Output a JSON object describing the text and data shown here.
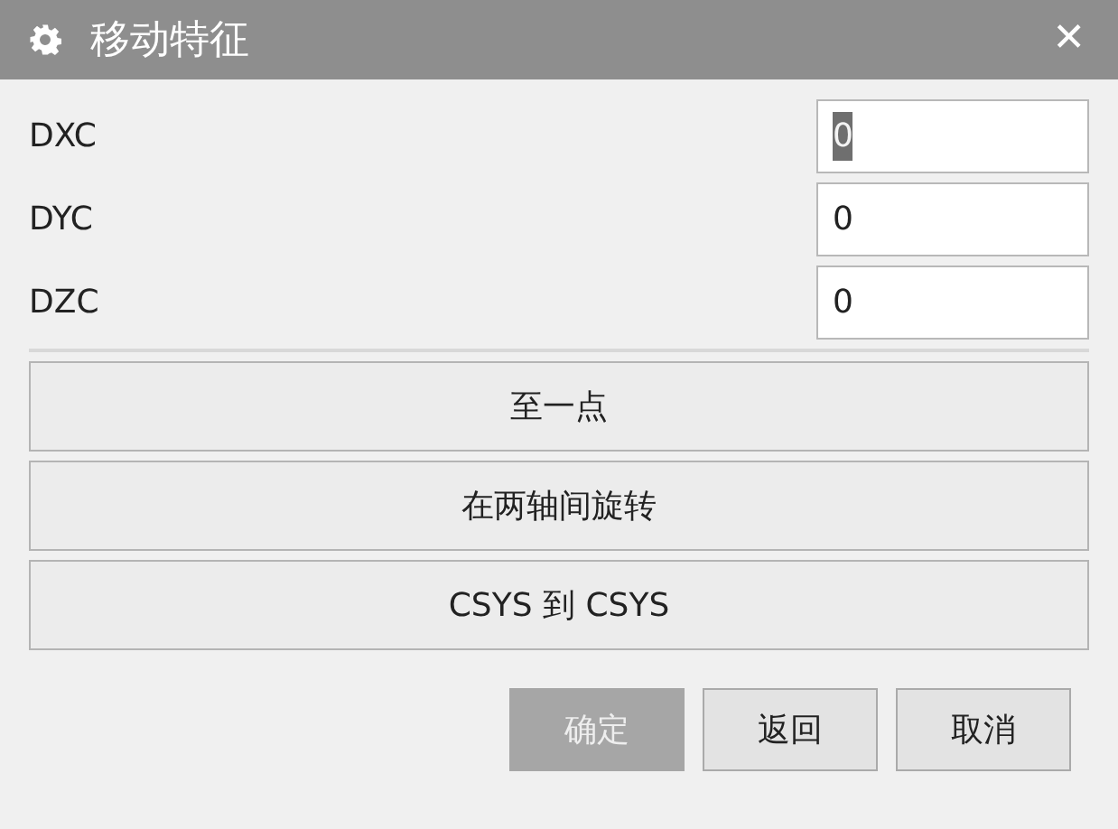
{
  "window": {
    "title": "移动特征",
    "close": "✕"
  },
  "fields": [
    {
      "label": "DXC",
      "value": "0",
      "text_selected": true
    },
    {
      "label": "DYC",
      "value": "0",
      "text_selected": false
    },
    {
      "label": "DZC",
      "value": "0",
      "text_selected": false
    }
  ],
  "actions": [
    "至一点",
    "在两轴间旋转",
    "CSYS 到 CSYS"
  ],
  "buttons": [
    {
      "label": "确定",
      "disabled": true
    },
    {
      "label": "返回",
      "disabled": false
    },
    {
      "label": "取消",
      "disabled": false
    }
  ]
}
